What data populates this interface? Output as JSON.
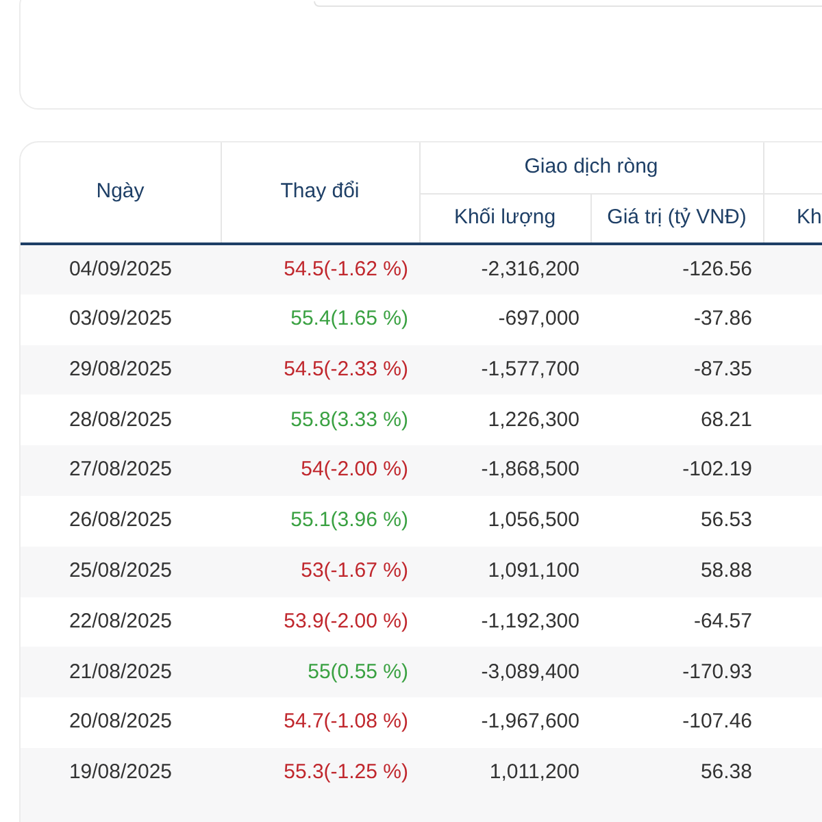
{
  "table": {
    "columns": [
      {
        "label": "Ngày"
      },
      {
        "label": "Thay đổi"
      }
    ],
    "group": {
      "label": "Giao dịch ròng",
      "columns": [
        "Khối lượng",
        "Giá trị (tỷ VNĐ)"
      ]
    },
    "column_5": "Kh",
    "rows": [
      {
        "date": "04/09/2025",
        "change": "54.5(-1.62 %)",
        "kind": "down",
        "volume": "-2,316,200",
        "value": "-126.56"
      },
      {
        "date": "03/09/2025",
        "change": "55.4(1.65 %)",
        "kind": "up",
        "volume": "-697,000",
        "value": "-37.86"
      },
      {
        "date": "29/08/2025",
        "change": "54.5(-2.33 %)",
        "kind": "down",
        "volume": "-1,577,700",
        "value": "-87.35"
      },
      {
        "date": "28/08/2025",
        "change": "55.8(3.33 %)",
        "kind": "up",
        "volume": "1,226,300",
        "value": "68.21"
      },
      {
        "date": "27/08/2025",
        "change": "54(-2.00 %)",
        "kind": "down",
        "volume": "-1,868,500",
        "value": "-102.19"
      },
      {
        "date": "26/08/2025",
        "change": "55.1(3.96 %)",
        "kind": "up",
        "volume": "1,056,500",
        "value": "56.53"
      },
      {
        "date": "25/08/2025",
        "change": "53(-1.67 %)",
        "kind": "down",
        "volume": "1,091,100",
        "value": "58.88"
      },
      {
        "date": "22/08/2025",
        "change": "53.9(-2.00 %)",
        "kind": "down",
        "volume": "-1,192,300",
        "value": "-64.57"
      },
      {
        "date": "21/08/2025",
        "change": "55(0.55 %)",
        "kind": "up",
        "volume": "-3,089,400",
        "value": "-170.93"
      },
      {
        "date": "20/08/2025",
        "change": "54.7(-1.08 %)",
        "kind": "down",
        "volume": "-1,967,600",
        "value": "-107.46"
      },
      {
        "date": "19/08/2025",
        "change": "55.3(-1.25 %)",
        "kind": "down",
        "volume": "1,011,200",
        "value": "56.38"
      }
    ]
  }
}
